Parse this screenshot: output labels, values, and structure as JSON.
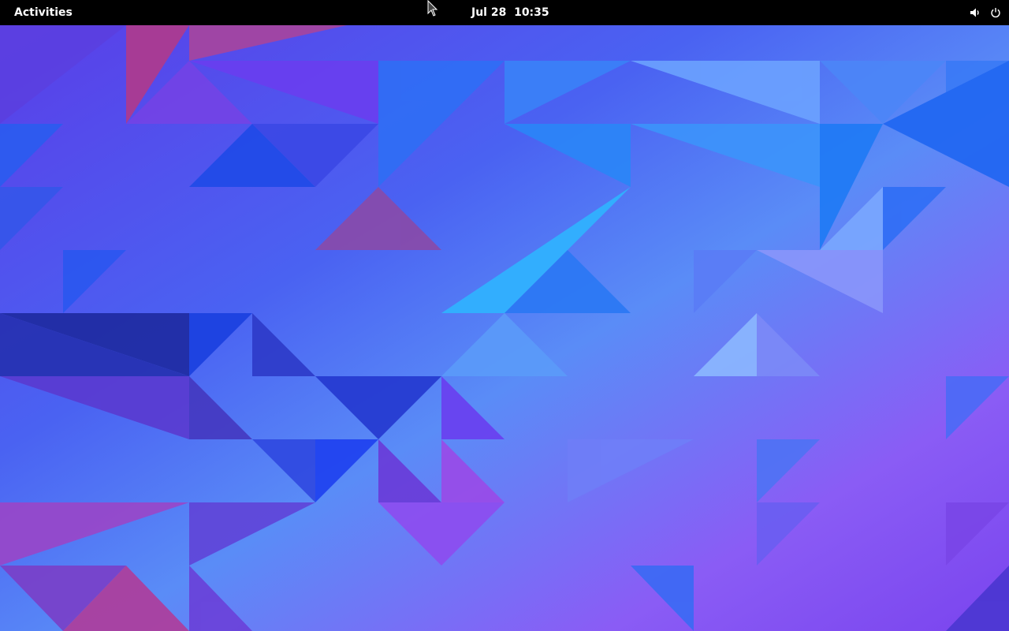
{
  "topbar": {
    "activities_label": "Activities",
    "clock_text": "Jul 28  10:35",
    "status_icons": [
      "volume-icon",
      "power-icon"
    ],
    "background": "#000000",
    "text_color": "#ffffff"
  },
  "desktop": {
    "wallpaper_style": "low-poly triangles",
    "palette": [
      "#4b2fd8",
      "#6a3ff0",
      "#2a6af5",
      "#3fa0ff",
      "#8a4ff5",
      "#b23a9a",
      "#1c2aa0"
    ]
  },
  "pointer": {
    "icon": "arrow-cursor-icon"
  }
}
